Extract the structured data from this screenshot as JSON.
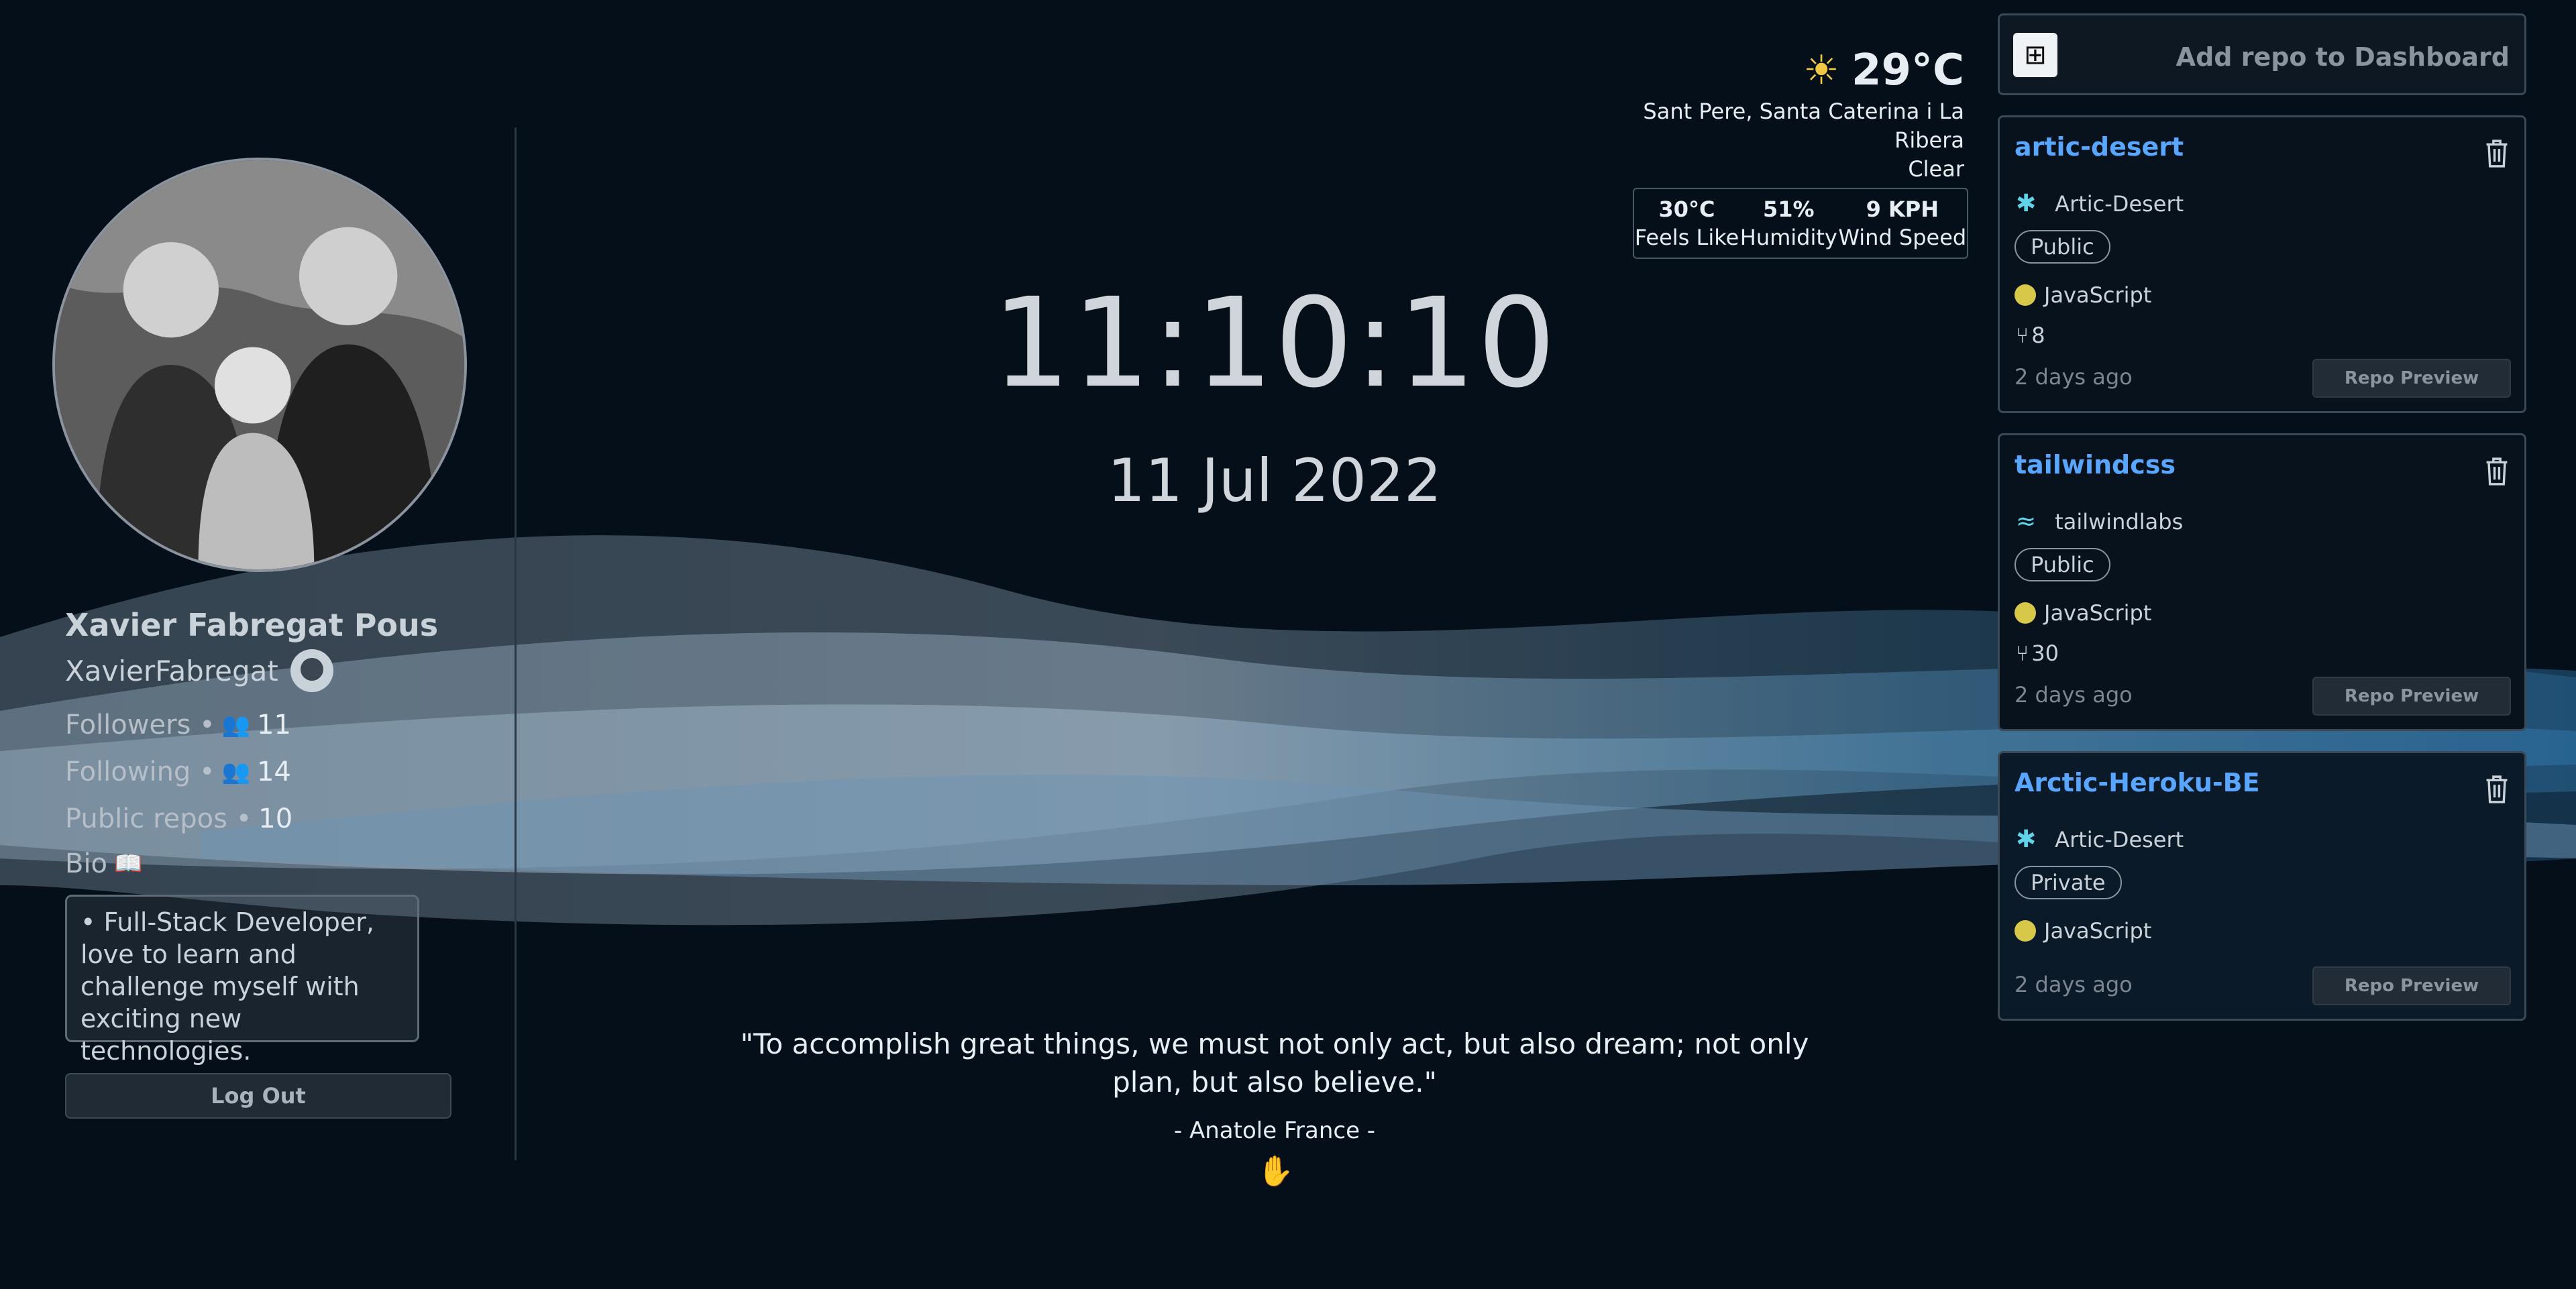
{
  "profile": {
    "name": "Xavier Fabregat Pous",
    "login": "XavierFabregat",
    "followers_label": "Followers •",
    "followers": "11",
    "following_label": "Following •",
    "following": "14",
    "repos_label": "Public repos •",
    "repos": "10",
    "bio_label": "Bio",
    "bio": "• Full-Stack Developer, love to learn and challenge myself with exciting new technologies.",
    "logout_label": "Log Out"
  },
  "clock": {
    "time": "11:10:10",
    "date": "11 Jul 2022"
  },
  "quote": {
    "text": "\"To accomplish great things, we must not only act, but also dream; not only plan, but also believe.\"",
    "author": "- Anatole France -"
  },
  "weather": {
    "temp": "29°C",
    "location": "Sant Pere, Santa Caterina i La Ribera",
    "condition": "Clear",
    "feels_like_value": "30°C",
    "feels_like_label": "Feels Like",
    "humidity_value": "51%",
    "humidity_label": "Humidity",
    "wind_value": "9 KPH",
    "wind_label": "Wind Speed",
    "icon": "sun-icon"
  },
  "dashboard": {
    "add_label": "Add repo to Dashboard"
  },
  "repos": [
    {
      "name": "artic-desert",
      "owner": "Artic-Desert",
      "visibility": "Public",
      "language": "JavaScript",
      "forks": "8",
      "updated": "2 days ago",
      "preview_label": "Repo Preview"
    },
    {
      "name": "tailwindcss",
      "owner": "tailwindlabs",
      "visibility": "Public",
      "language": "JavaScript",
      "forks": "30",
      "updated": "2 days ago",
      "preview_label": "Repo Preview"
    },
    {
      "name": "Arctic-Heroku-BE",
      "owner": "Artic-Desert",
      "visibility": "Private",
      "language": "JavaScript",
      "updated": "2 days ago",
      "preview_label": "Repo Preview"
    }
  ],
  "colors": {
    "background": "#050f19",
    "accent": "#58a6ff",
    "language_dot": "#d8c84a",
    "sun": "#f2c744"
  }
}
